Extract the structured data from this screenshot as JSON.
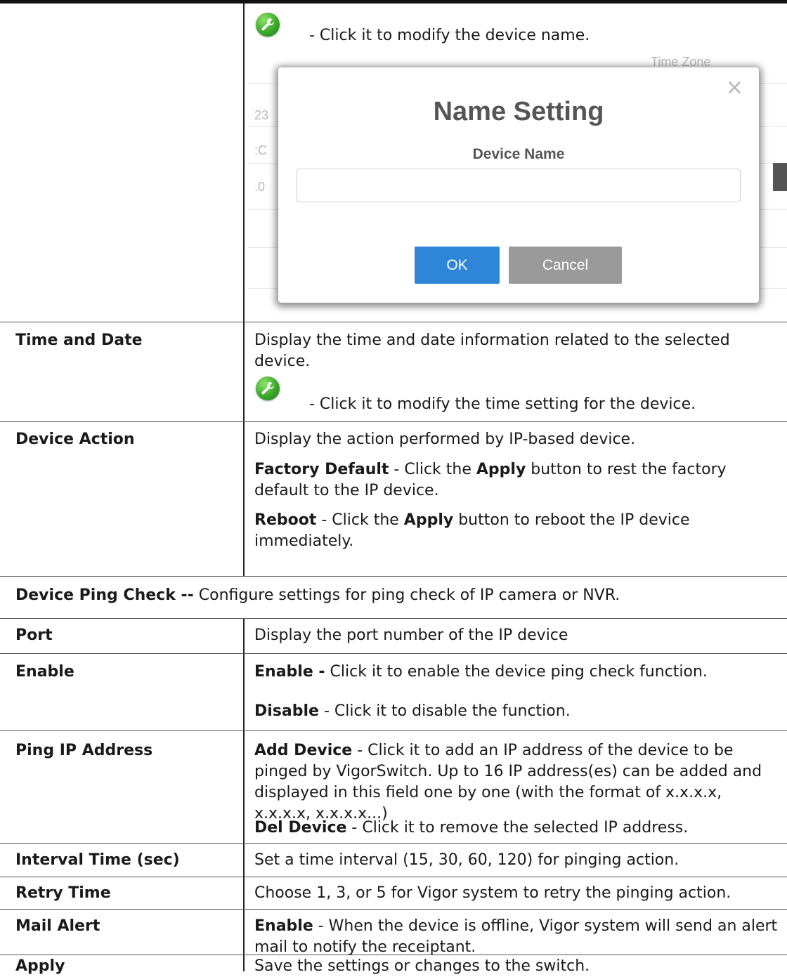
{
  "rows": {
    "device_name": {
      "wrench_note": "- Click it to modify the device name."
    },
    "time_and_date": {
      "label": "Time and Date",
      "text": "Display the time and date information related to the selected device.",
      "wrench_note": "- Click it to modify the time setting for the device."
    },
    "device_action": {
      "label": "Device Action",
      "line1": "Display the action performed by IP-based device.",
      "factory_term": "Factory Default",
      "factory_pre": " - Click the ",
      "apply_term": "Apply",
      "factory_post": " button to rest the factory default to the IP device.",
      "reboot_term": "Reboot",
      "reboot_pre": " - Click the ",
      "reboot_post": " button to reboot the IP device immediately."
    },
    "ping_check": {
      "term": "Device Ping Check --",
      "text": " Configure settings for ping check of IP camera or NVR."
    },
    "port": {
      "label": "Port",
      "text": "Display the port number of the IP device"
    },
    "enable": {
      "label": "Enable",
      "enable_term": "Enable -",
      "enable_text": " Click it to enable the device ping check function.",
      "disable_term": "Disable",
      "disable_text": " - Click it to disable the function."
    },
    "ping_ip": {
      "label": "Ping IP Address",
      "add_term": "Add Device",
      "add_text": " - Click it to add an IP address of the device to be pinged by VigorSwitch. Up to 16 IP address(es) can be added and displayed in this field one by one (with the format of x.x.x.x, x.x.x.x, x.x.x.x...)",
      "del_term": "Del Device",
      "del_text": " - Click it to remove the selected IP address."
    },
    "interval": {
      "label": "Interval Time (sec)",
      "text": "Set a time interval (15, 30, 60, 120) for pinging action."
    },
    "retry": {
      "label": "Retry Time",
      "text": "Choose 1, 3, or 5 for Vigor system to retry the pinging action."
    },
    "mail_alert": {
      "label": "Mail Alert",
      "term": "Enable",
      "text": " - When the device is offline, Vigor system will send an alert mail to notify the receiptant."
    },
    "apply": {
      "label": "Apply",
      "text": "Save the settings or changes to the switch."
    }
  },
  "dialog": {
    "title": "Name Setting",
    "field_label": "Device Name",
    "input_value": "",
    "ok_label": "OK",
    "cancel_label": "Cancel",
    "close_glyph": "×",
    "background_fragments": {
      "time_zone": "Time Zone",
      "frag1": "23",
      "frag2": ":C",
      "frag3": ".0"
    }
  },
  "icons": {
    "wrench": "wrench-icon",
    "close": "close-icon"
  },
  "colors": {
    "ok_button": "#2f86d9",
    "cancel_button": "#9a9a9a",
    "wrench_green": "#3aa82a"
  }
}
